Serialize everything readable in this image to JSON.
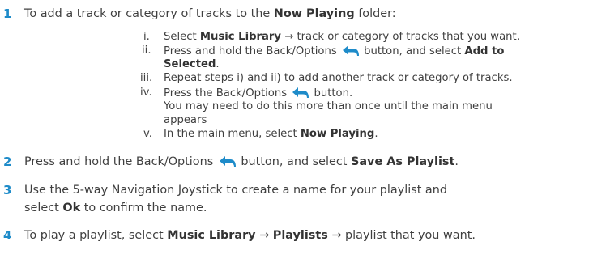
{
  "steps": {
    "s1": {
      "num": "1",
      "pre": "To add a track or category of tracks to the ",
      "b1": "Now Playing",
      "post": " folder:",
      "sub": {
        "i": {
          "label": "i.",
          "pre": "Select ",
          "b1": "Music Library",
          "post": " → track or category of tracks that you want."
        },
        "ii": {
          "label": "ii.",
          "pre": "Press and hold the Back/Options ",
          "mid": " button, and select ",
          "b1a": "Add to",
          "b1b": "Selected",
          "post": "."
        },
        "iii": {
          "label": "iii.",
          "text": "Repeat steps i) and ii) to add another track or category of tracks."
        },
        "iv": {
          "label": "iv.",
          "pre": "Press the Back/Options ",
          "post": " button.",
          "line2": "You may need to do this more than once until the main menu",
          "line3": "appears"
        },
        "v": {
          "label": "v.",
          "pre": "In the main menu, select ",
          "b1": "Now Playing",
          "post": "."
        }
      }
    },
    "s2": {
      "num": "2",
      "pre": "Press and hold the Back/Options ",
      "mid": " button, and select ",
      "b1": "Save As Playlist",
      "post": "."
    },
    "s3": {
      "num": "3",
      "line1": "Use the 5-way Navigation Joystick to create a name for your playlist and",
      "pre2": "select ",
      "b1": "Ok",
      "post2": " to confirm the name."
    },
    "s4": {
      "num": "4",
      "pre": "To play a playlist, select ",
      "b1": "Music Library",
      "mid": " → ",
      "b2": "Playlists",
      "post": " → playlist that you want."
    }
  },
  "colors": {
    "accent": "#1e8bc9",
    "text": "#3f3f3f"
  },
  "icons": {
    "back": "back-arrow-icon"
  }
}
